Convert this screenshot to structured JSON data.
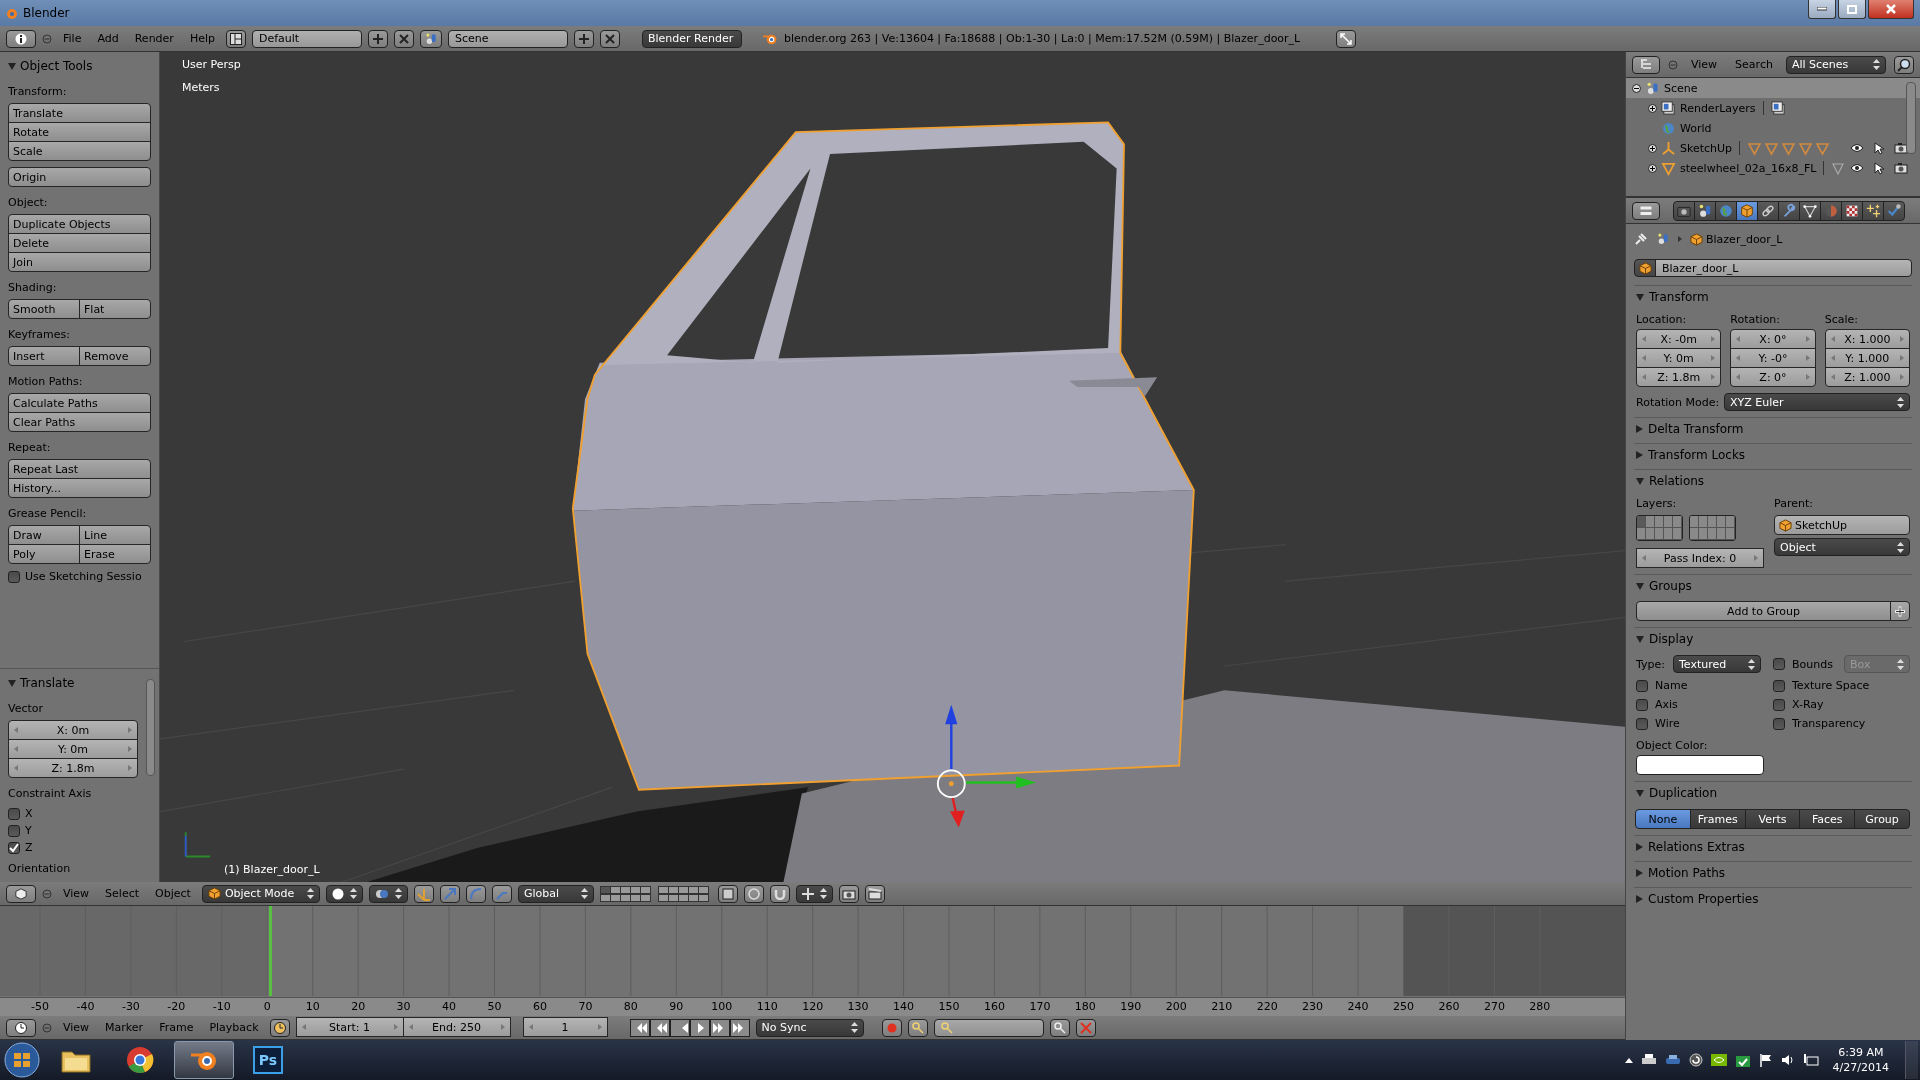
{
  "title_bar": {
    "title": "Blender"
  },
  "info_header": {
    "menus": [
      "File",
      "Add",
      "Render",
      "Help"
    ],
    "screen": "Default",
    "scene": "Scene",
    "engine": "Blender Render",
    "stats": "blender.org 263 | Ve:13604 | Fa:18688 | Ob:1-30 | La:0 | Mem:17.52M (0.59M) | Blazer_door_L"
  },
  "tool_shelf": {
    "title": "Object Tools",
    "sections": [
      {
        "label": "Transform:",
        "rows": [
          [
            "Translate"
          ],
          [
            "Rotate"
          ],
          [
            "Scale"
          ]
        ]
      },
      {
        "rows": [
          [
            "Origin"
          ]
        ]
      },
      {
        "label": "Object:",
        "rows": [
          [
            "Duplicate Objects"
          ],
          [
            "Delete"
          ],
          [
            "Join"
          ]
        ]
      },
      {
        "label": "Shading:",
        "rows": [
          [
            "Smooth",
            "Flat"
          ]
        ]
      },
      {
        "label": "Keyframes:",
        "rows": [
          [
            "Insert",
            "Remove"
          ]
        ]
      },
      {
        "label": "Motion Paths:",
        "rows": [
          [
            "Calculate Paths"
          ],
          [
            "Clear Paths"
          ]
        ]
      },
      {
        "label": "Repeat:",
        "rows": [
          [
            "Repeat Last"
          ],
          [
            "History..."
          ]
        ]
      },
      {
        "label": "Grease Pencil:",
        "rows": [
          [
            "Draw",
            "Line"
          ],
          [
            "Poly",
            "Erase"
          ]
        ]
      }
    ],
    "sketching": {
      "label": "Use Sketching Sessio",
      "checked": false
    }
  },
  "operator_panel": {
    "title": "Translate",
    "vector_label": "Vector",
    "vector": [
      "X: 0m",
      "Y: 0m",
      "Z: 1.8m"
    ],
    "constraint_label": "Constraint Axis",
    "axes": [
      {
        "label": "X",
        "checked": false
      },
      {
        "label": "Y",
        "checked": false
      },
      {
        "label": "Z",
        "checked": true
      }
    ],
    "orientation_label": "Orientation"
  },
  "viewport": {
    "view_name": "User Persp",
    "units": "Meters",
    "object_label": "(1) Blazer_door_L"
  },
  "viewport_header": {
    "menus": [
      "View",
      "Select",
      "Object"
    ],
    "mode": "Object Mode",
    "orientation": "Global"
  },
  "timeline": {
    "ticks": [
      "-50",
      "-40",
      "-30",
      "-20",
      "-10",
      "0",
      "10",
      "20",
      "30",
      "40",
      "50",
      "60",
      "70",
      "80",
      "90",
      "100",
      "110",
      "120",
      "130",
      "140",
      "150",
      "160",
      "170",
      "180",
      "190",
      "200",
      "210",
      "220",
      "230",
      "240",
      "250",
      "260",
      "270",
      "280"
    ],
    "menus": [
      "View",
      "Marker",
      "Frame",
      "Playback"
    ],
    "start": "Start: 1",
    "end": "End: 250",
    "current": "1",
    "sync": "No Sync"
  },
  "outliner": {
    "menus": [
      "View",
      "Search"
    ],
    "filter": "All Scenes",
    "items": [
      {
        "label": "Scene",
        "kind": "scene",
        "selected": true,
        "expanded": true,
        "children": [
          {
            "label": "RenderLayers",
            "kind": "renderlayers",
            "selected": false,
            "expanded": false
          },
          {
            "label": "World",
            "kind": "world",
            "selected": false
          },
          {
            "label": "SketchUp",
            "kind": "empty",
            "selected": false,
            "expanded": false
          },
          {
            "label": "steelwheel_02a_16x8_FL",
            "kind": "mesh",
            "selected": false,
            "expanded": false
          }
        ]
      }
    ]
  },
  "properties": {
    "tabs": [
      {
        "kind": "render",
        "selected": false
      },
      {
        "kind": "scene",
        "selected": false
      },
      {
        "kind": "world",
        "selected": false
      },
      {
        "kind": "object",
        "selected": true
      },
      {
        "kind": "constraints",
        "selected": false
      },
      {
        "kind": "modifiers",
        "selected": false
      },
      {
        "kind": "data",
        "selected": false
      },
      {
        "kind": "material",
        "selected": false
      },
      {
        "kind": "texture",
        "selected": false
      },
      {
        "kind": "particles",
        "selected": false
      },
      {
        "kind": "physics",
        "selected": false
      }
    ],
    "breadcrumb": "Blazer_door_L",
    "object_name": "Blazer_door_L",
    "panels": [
      {
        "kind": "transform",
        "title": "Transform",
        "expanded": true,
        "columns": [
          {
            "label": "Location:",
            "fields": [
              "X: -0m",
              "Y: 0m",
              "Z: 1.8m"
            ]
          },
          {
            "label": "Rotation:",
            "fields": [
              "X: 0°",
              "Y: -0°",
              "Z: 0°"
            ]
          },
          {
            "label": "Scale:",
            "fields": [
              "X: 1.000",
              "Y: 1.000",
              "Z: 1.000"
            ]
          }
        ],
        "rotation_mode_label": "Rotation Mode:",
        "rotation_mode": "XYZ Euler"
      },
      {
        "kind": "plain",
        "title": "Delta Transform",
        "expanded": false
      },
      {
        "kind": "plain",
        "title": "Transform Locks",
        "expanded": false
      },
      {
        "kind": "relations",
        "title": "Relations",
        "expanded": true,
        "layers_label": "Layers:",
        "layers": [
          {
            "on": true
          },
          {
            "on": false
          },
          {
            "on": false
          },
          {
            "on": false
          },
          {
            "on": false
          },
          {
            "on": false
          },
          {
            "on": false
          },
          {
            "on": false
          },
          {
            "on": false
          },
          {
            "on": false
          },
          {
            "on": false
          },
          {
            "on": false
          },
          {
            "on": false
          },
          {
            "on": false
          },
          {
            "on": false
          },
          {
            "on": false
          },
          {
            "on": false
          },
          {
            "on": false
          },
          {
            "on": false
          },
          {
            "on": false
          }
        ],
        "parent_label": "Parent:",
        "parent": "SketchUp",
        "parent_type": "Object",
        "pass_index": "Pass Index: 0"
      },
      {
        "kind": "groups",
        "title": "Groups",
        "expanded": true,
        "button": "Add to Group"
      },
      {
        "kind": "display",
        "title": "Display",
        "expanded": true,
        "type_label": "Type:",
        "type": "Textured",
        "bounds": {
          "label": "Bounds",
          "checked": false
        },
        "bounds_type": "Box",
        "options": [
          {
            "label": "Name",
            "checked": false
          },
          {
            "label": "Texture Space",
            "checked": false
          },
          {
            "label": "Axis",
            "checked": false
          },
          {
            "label": "X-Ray",
            "checked": false
          },
          {
            "label": "Wire",
            "checked": false
          },
          {
            "label": "Transparency",
            "checked": false
          }
        ],
        "color_label": "Object Color:",
        "color": "#ffffff"
      },
      {
        "kind": "duplication",
        "title": "Duplication",
        "expanded": true,
        "options": [
          {
            "label": "None",
            "selected": true
          },
          {
            "label": "Frames",
            "selected": false
          },
          {
            "label": "Verts",
            "selected": false
          },
          {
            "label": "Faces",
            "selected": false
          },
          {
            "label": "Group",
            "selected": false
          }
        ]
      },
      {
        "kind": "plain",
        "title": "Relations Extras",
        "expanded": false
      },
      {
        "kind": "plain",
        "title": "Motion Paths",
        "expanded": false
      },
      {
        "kind": "plain",
        "title": "Custom Properties",
        "expanded": false
      }
    ]
  },
  "taskbar": {
    "apps": [
      {
        "kind": "explorer",
        "selected": false
      },
      {
        "kind": "chrome",
        "selected": false
      },
      {
        "kind": "blender",
        "selected": true
      },
      {
        "kind": "photoshop",
        "label": "Ps",
        "selected": false
      }
    ],
    "time": "6:39 AM",
    "date": "4/27/2014"
  }
}
